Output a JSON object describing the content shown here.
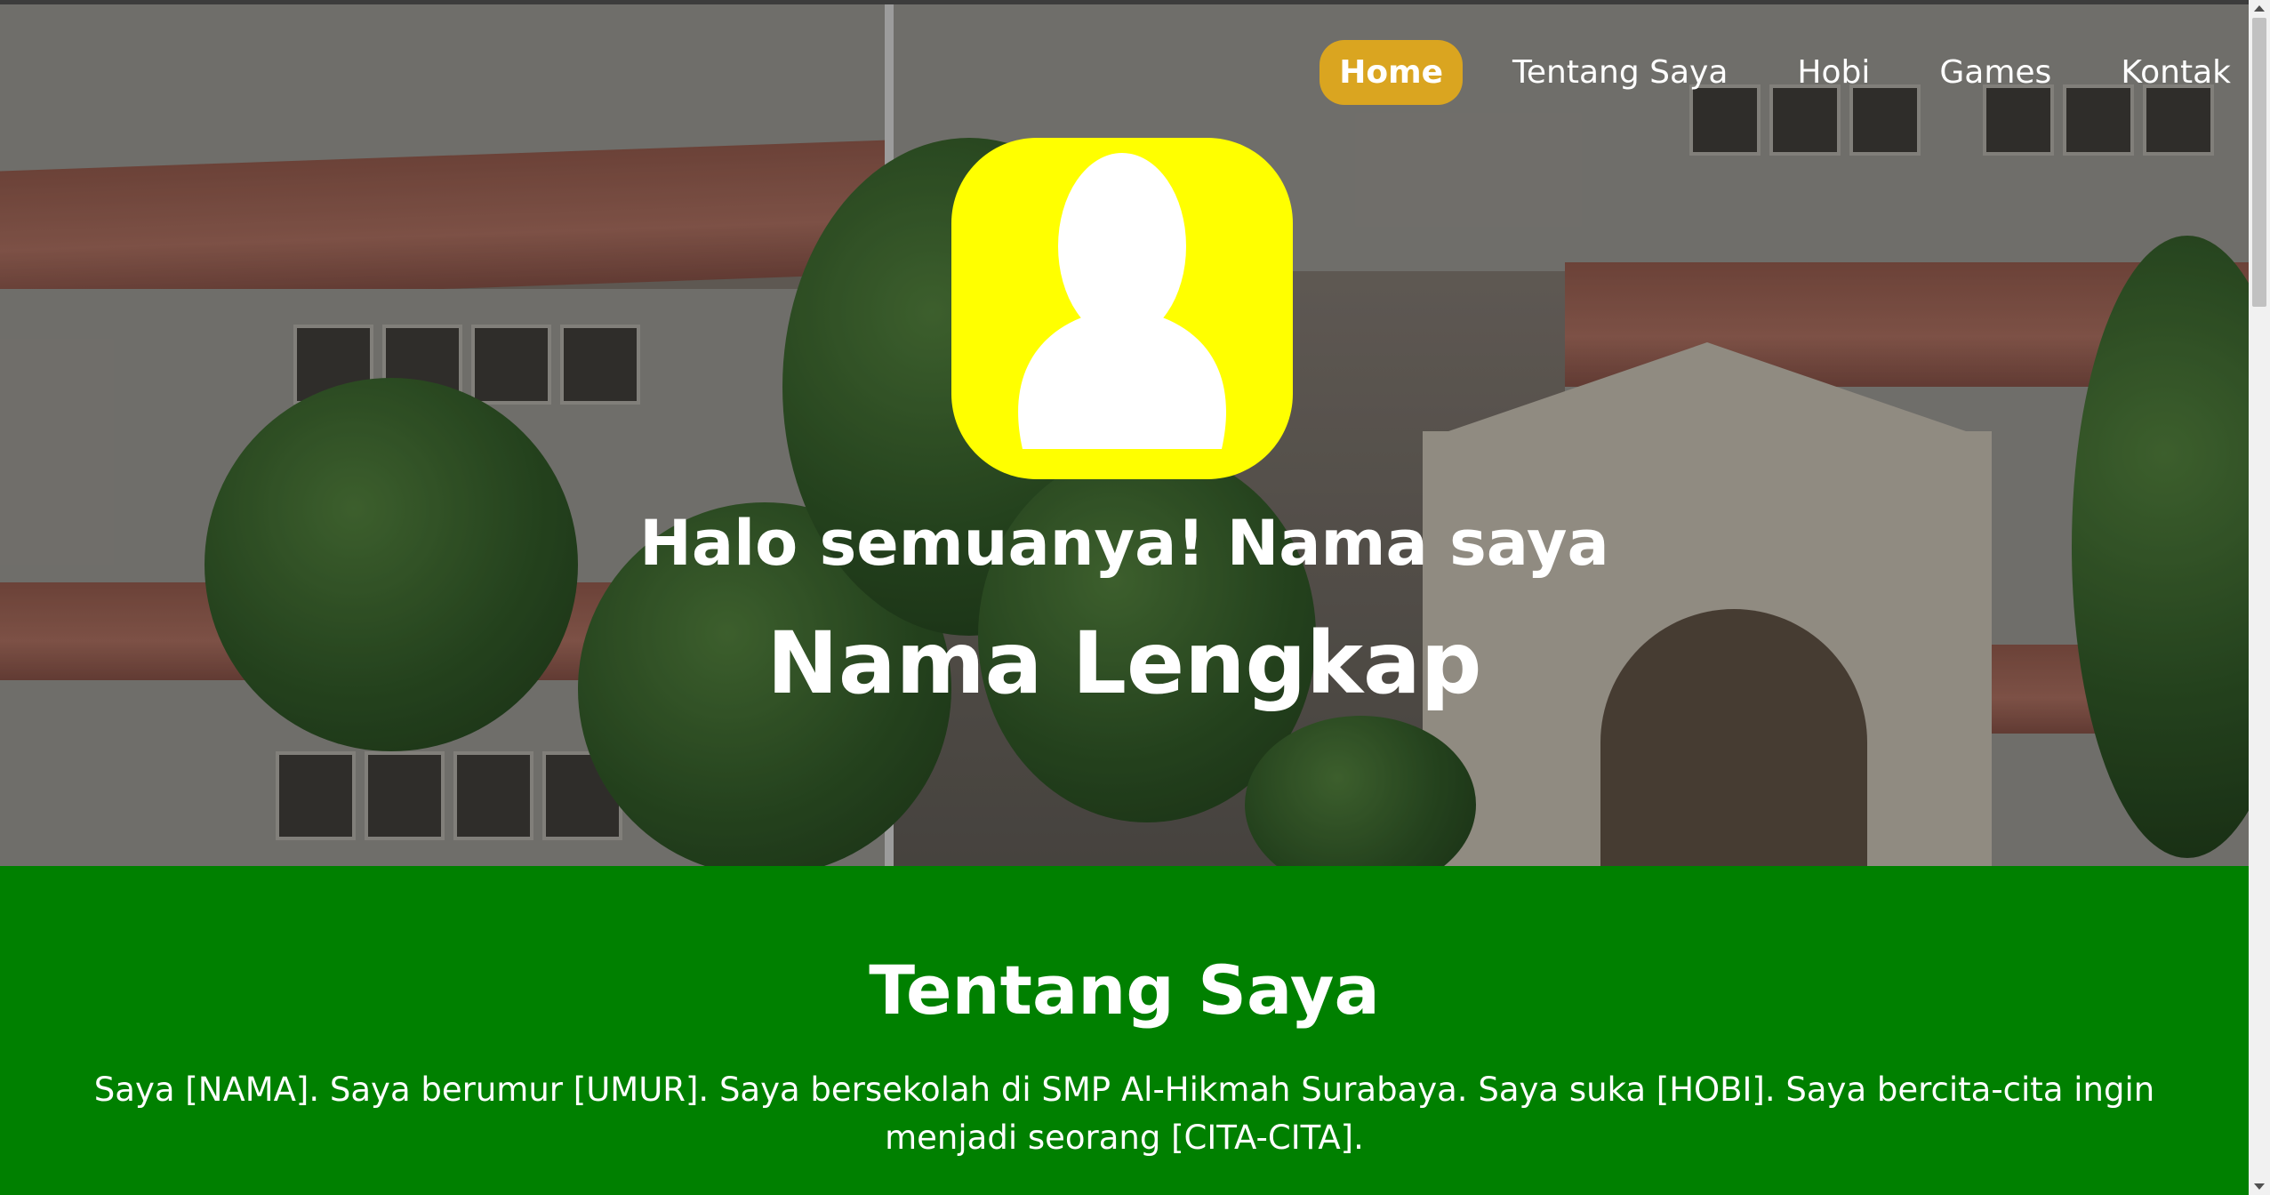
{
  "nav": {
    "items": [
      {
        "label": "Home",
        "active": true
      },
      {
        "label": "Tentang Saya",
        "active": false
      },
      {
        "label": "Hobi",
        "active": false
      },
      {
        "label": "Games",
        "active": false
      },
      {
        "label": "Kontak",
        "active": false
      }
    ]
  },
  "hero": {
    "greeting": "Halo semuanya! Nama saya",
    "name": "Nama Lengkap",
    "avatar_icon": "user-silhouette-icon"
  },
  "about": {
    "title": "Tentang Saya",
    "text": "Saya [NAMA]. Saya berumur [UMUR]. Saya bersekolah di SMP Al-Hikmah Surabaya. Saya suka [HOBI]. Saya bercita-cita ingin menjadi seorang [CITA-CITA]."
  },
  "colors": {
    "nav_active": "#daa520",
    "avatar_bg": "#ffff00",
    "about_bg": "#008000",
    "text": "#ffffff"
  }
}
